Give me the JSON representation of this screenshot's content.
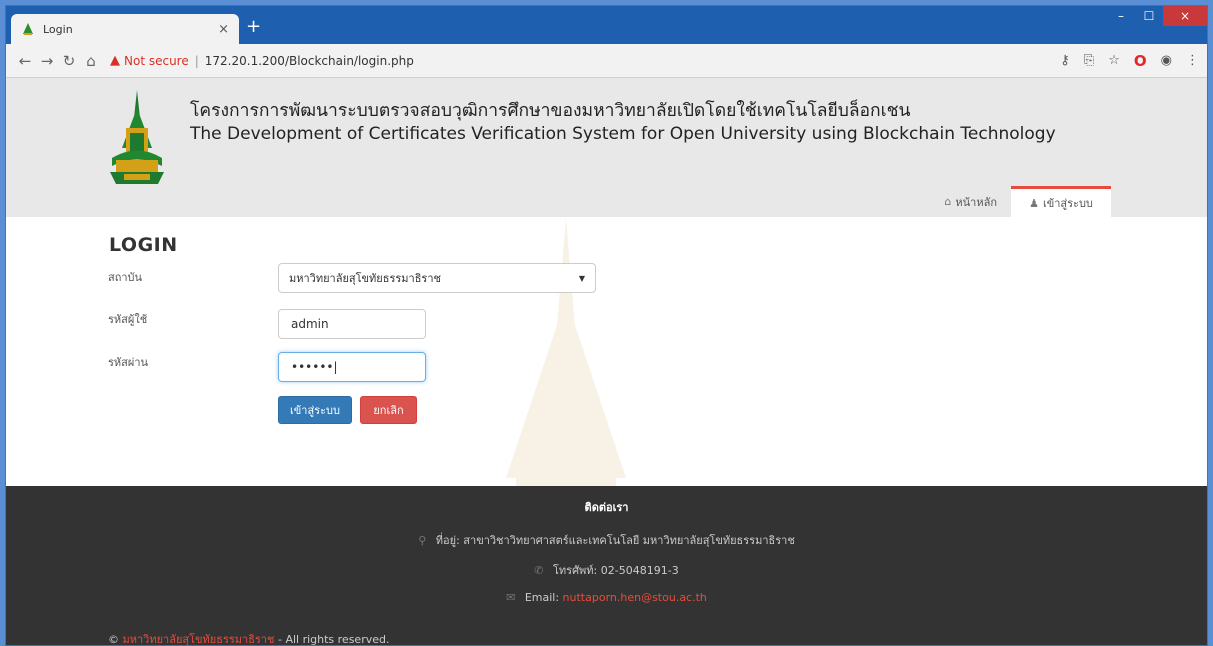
{
  "browser": {
    "tab_title": "Login",
    "tab_close": "×",
    "new_tab": "+",
    "not_secure": "Not secure",
    "separator": "|",
    "url": "172.20.1.200/Blockchain/login.php",
    "win_min": "–",
    "win_max": "☐",
    "win_close": "×"
  },
  "header": {
    "title_th": "โครงการการพัฒนาระบบตรวจสอบวุฒิการศึกษาของมหาวิทยาลัยเปิดโดยใช้เทคโนโลยีบล็อกเชน",
    "title_en": "The Development of Certificates Verification System for Open University using Blockchain Technology",
    "nav": [
      {
        "label": "หน้าหลัก",
        "icon": "home-icon"
      },
      {
        "label": "เข้าสู่ระบบ",
        "icon": "user-icon"
      }
    ]
  },
  "form": {
    "heading": "LOGIN",
    "institution_label": "สถาบัน",
    "institution_value": "มหาวิทยาลัยสุโขทัยธรรมาธิราช",
    "username_label": "รหัสผู้ใช้",
    "username_value": "admin",
    "password_label": "รหัสผ่าน",
    "password_value": "••••••|",
    "login_button": "เข้าสู่ระบบ",
    "cancel_button": "ยกเลิก"
  },
  "footer": {
    "title": "ติดต่อเรา",
    "address_label": "ที่อยู่:",
    "address_value": "สาขาวิชาวิทยาศาสตร์และเทคโนโลยี มหาวิทยาลัยสุโขทัยธรรมาธิราช",
    "phone_label": "โทรศัพท์:",
    "phone_value": "02-5048191-3",
    "email_label": "Email:",
    "email_value": "nuttaporn.hen@stou.ac.th",
    "copyright_symbol": "©",
    "copyright_org": "มหาวิทยาลัยสุโขทัยธรรมาธิราช",
    "copyright_text": " - All rights reserved."
  },
  "colors": {
    "accent_red": "#e74c3c",
    "primary_blue": "#337ab7",
    "danger_red": "#d9534f",
    "footer_bg": "#333333",
    "header_bg": "#e8e8e8"
  }
}
